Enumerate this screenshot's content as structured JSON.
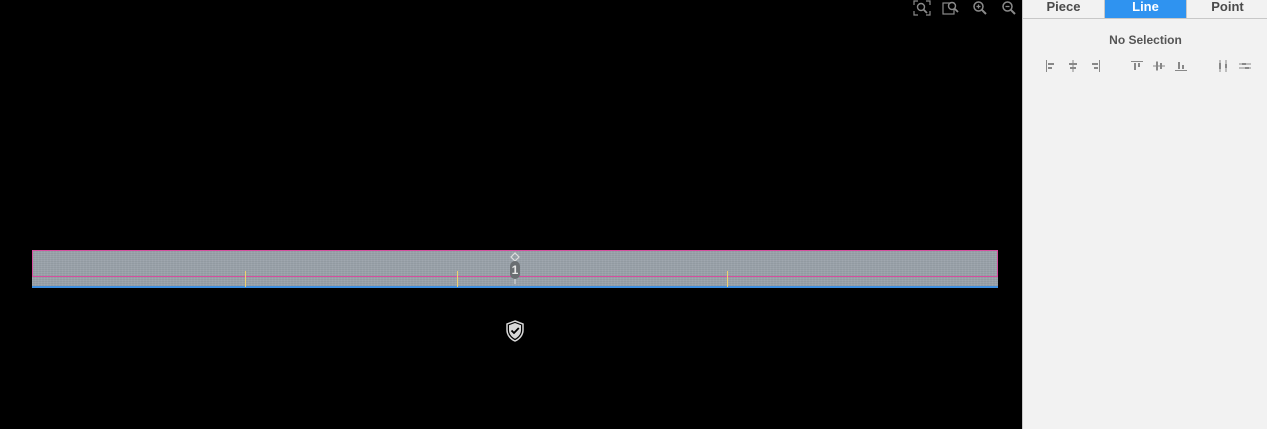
{
  "canvas": {
    "background": "#000000",
    "zoom_tools": [
      {
        "icon": "zoom-fit-icon"
      },
      {
        "icon": "zoom-selection-icon"
      },
      {
        "icon": "zoom-in-icon"
      },
      {
        "icon": "zoom-out-icon"
      }
    ],
    "piece": {
      "fill": "#9aa2aa",
      "outline_color": "#d64fa0",
      "edge_color": "#3e8fe0",
      "tick_color": "#f0d070"
    },
    "marker": {
      "label": "1"
    },
    "status_icon": "shield-check-icon"
  },
  "panel": {
    "tabs": [
      {
        "label": "Piece",
        "active": false
      },
      {
        "label": "Line",
        "active": true
      },
      {
        "label": "Point",
        "active": false
      }
    ],
    "accent": "#2f93f0",
    "no_selection_text": "No Selection",
    "align_tools": [
      {
        "icon": "align-left-icon"
      },
      {
        "icon": "align-center-horizontal-icon"
      },
      {
        "icon": "align-right-icon"
      },
      {
        "icon": "align-top-icon"
      },
      {
        "icon": "align-middle-vertical-icon"
      },
      {
        "icon": "align-bottom-icon"
      },
      {
        "icon": "distribute-horizontal-icon"
      },
      {
        "icon": "distribute-vertical-icon"
      }
    ]
  }
}
